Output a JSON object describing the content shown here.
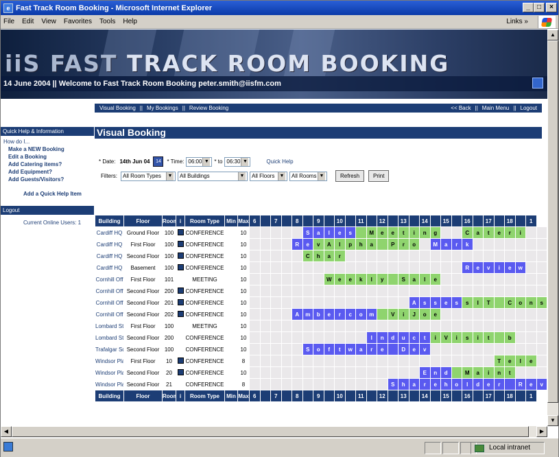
{
  "window": {
    "title": "Fast Track Room Booking - Microsoft Internet Explorer"
  },
  "menu": {
    "items": [
      "File",
      "Edit",
      "View",
      "Favorites",
      "Tools",
      "Help"
    ],
    "links_label": "Links »"
  },
  "banner": {
    "title_a": "iiS FAST",
    "title_b": " TRACK ROOM BOOKING",
    "strip": "14 June 2004   ||   Welcome to Fast Track Room Booking peter.smith@iisfm.com"
  },
  "topnav": {
    "left": [
      "Visual Booking",
      "||",
      "My Bookings",
      "||",
      "Review Booking"
    ],
    "right": [
      "<< Back",
      "||",
      "Main Menu",
      "||",
      "Logout"
    ]
  },
  "sidebar": {
    "quick_help_head": "Quick Help & Information",
    "how_do_i": "How do I...",
    "links": [
      "Make a NEW Booking",
      "Edit a Booking",
      "Add Catering items?",
      "Add Equipment?",
      "Add Guests/Visitors?"
    ],
    "add_quick_help": "Add a Quick Help Item",
    "logout_head": "Logout",
    "online_users": "Current Online Users: 1"
  },
  "main": {
    "title": "Visual Booking",
    "date_label": "* Date:",
    "date_value": "14th Jun 04",
    "time_label": "* Time:",
    "time_from": "06:00",
    "to_label": "* to",
    "time_to": "06:30",
    "quick_help": "Quick Help",
    "filters_label": "Filters:",
    "filter_room_types": "All Room Types",
    "filter_buildings": "All Buildings",
    "filter_floors": "All Floors",
    "filter_rooms": "All Rooms",
    "refresh": "Refresh",
    "print": "Print"
  },
  "grid": {
    "headers": [
      "Building",
      "Floor",
      "Room",
      "i",
      "Room Type",
      "Min",
      "Max",
      "6",
      "",
      "7",
      "",
      "8",
      "",
      "9",
      "",
      "10",
      "",
      "11",
      "",
      "12",
      "",
      "13",
      "",
      "14",
      "",
      "15",
      "",
      "16",
      "",
      "17",
      "",
      "18",
      "",
      "1"
    ],
    "rows": [
      {
        "b": "Cardiff HQ",
        "f": "Ground Floor",
        "r": "100",
        "i": true,
        "t": "CONFERENCE",
        "max": "10",
        "cells": [
          "",
          "",
          "",
          "",
          "",
          [
            "bl",
            "S"
          ],
          [
            "bl",
            "a"
          ],
          [
            "bl",
            "l"
          ],
          [
            "bl",
            "e"
          ],
          [
            "bl",
            "s"
          ],
          [
            "gr",
            ""
          ],
          [
            "gr",
            "M"
          ],
          [
            "gr",
            "e"
          ],
          [
            "gr",
            "e"
          ],
          [
            "gr",
            "t"
          ],
          [
            "gr",
            "i"
          ],
          [
            "gr",
            "n"
          ],
          [
            "gr",
            "g"
          ],
          "",
          "",
          [
            "gr",
            "C"
          ],
          [
            "gr",
            "a"
          ],
          [
            "gr",
            "t"
          ],
          [
            "gr",
            "e"
          ],
          [
            "gr",
            "r"
          ],
          [
            "gr",
            "i"
          ]
        ]
      },
      {
        "b": "Cardiff HQ",
        "f": "First Floor",
        "r": "100",
        "i": true,
        "t": "CONFERENCE",
        "max": "10",
        "cells": [
          "",
          "",
          "",
          "",
          [
            "bl",
            "R"
          ],
          [
            "bl",
            "e"
          ],
          [
            "gr",
            "v"
          ],
          [
            "gr",
            "A"
          ],
          [
            "gr",
            "l"
          ],
          [
            "gr",
            "p"
          ],
          [
            "gr",
            "h"
          ],
          [
            "gr",
            "a"
          ],
          [
            "gr",
            ""
          ],
          [
            "gr",
            "P"
          ],
          [
            "gr",
            "r"
          ],
          [
            "gr",
            "o"
          ],
          "",
          [
            "bl",
            "M"
          ],
          [
            "bl",
            "a"
          ],
          [
            "bl",
            "r"
          ],
          [
            "bl",
            "k"
          ],
          "",
          "",
          "",
          "",
          ""
        ]
      },
      {
        "b": "Cardiff HQ",
        "f": "Second Floor",
        "r": "100",
        "i": true,
        "t": "CONFERENCE",
        "max": "10",
        "cells": [
          "",
          "",
          "",
          "",
          "",
          [
            "gr",
            "C"
          ],
          [
            "gr",
            "h"
          ],
          [
            "gr",
            "a"
          ],
          [
            "gr",
            "r"
          ],
          "",
          "",
          "",
          "",
          "",
          "",
          "",
          "",
          "",
          "",
          "",
          "",
          "",
          "",
          "",
          "",
          ""
        ]
      },
      {
        "b": "Cardiff HQ",
        "f": "Basement",
        "r": "100",
        "i": true,
        "t": "CONFERENCE",
        "max": "10",
        "cells": [
          "",
          "",
          "",
          "",
          "",
          "",
          "",
          "",
          "",
          "",
          "",
          "",
          "",
          "",
          "",
          "",
          "",
          "",
          "",
          "",
          [
            "bl",
            "R"
          ],
          [
            "bl",
            "e"
          ],
          [
            "bl",
            "v"
          ],
          [
            "bl",
            "i"
          ],
          [
            "bl",
            "e"
          ],
          [
            "bl",
            "w"
          ]
        ]
      },
      {
        "b": "Cornhill Off",
        "f": "First Floor",
        "r": "101",
        "i": false,
        "t": "MEETING",
        "max": "10",
        "cells": [
          "",
          "",
          "",
          "",
          "",
          "",
          "",
          [
            "gr",
            "W"
          ],
          [
            "gr",
            "e"
          ],
          [
            "gr",
            "e"
          ],
          [
            "gr",
            "k"
          ],
          [
            "gr",
            "l"
          ],
          [
            "gr",
            "y"
          ],
          [
            "gr",
            ""
          ],
          [
            "gr",
            "S"
          ],
          [
            "gr",
            "a"
          ],
          [
            "gr",
            "l"
          ],
          [
            "gr",
            "e"
          ],
          "",
          "",
          "",
          "",
          "",
          "",
          "",
          ""
        ]
      },
      {
        "b": "Cornhill Off",
        "f": "Second Floor",
        "r": "200",
        "i": true,
        "t": "CONFERENCE",
        "max": "10",
        "cells": [
          "",
          "",
          "",
          "",
          "",
          "",
          "",
          "",
          "",
          "",
          "",
          "",
          "",
          "",
          "",
          "",
          "",
          "",
          "",
          "",
          "",
          "",
          "",
          "",
          "",
          ""
        ]
      },
      {
        "b": "Cornhill Off",
        "f": "Second Floor",
        "r": "201",
        "i": true,
        "t": "CONFERENCE",
        "max": "10",
        "cells": [
          "",
          "",
          "",
          "",
          "",
          "",
          "",
          "",
          "",
          "",
          "",
          "",
          "",
          "",
          "",
          [
            "bl",
            "A"
          ],
          [
            "bl",
            "s"
          ],
          [
            "bl",
            "s"
          ],
          [
            "bl",
            "e"
          ],
          [
            "bl",
            "s"
          ],
          [
            "gr",
            "s"
          ],
          [
            "gr",
            "I"
          ],
          [
            "gr",
            "T"
          ],
          [
            "gr",
            ""
          ],
          [
            "gr",
            "C"
          ],
          [
            "gr",
            "o"
          ],
          [
            "gr",
            "n"
          ],
          [
            "gr",
            "s"
          ]
        ]
      },
      {
        "b": "Cornhill Off",
        "f": "Second Floor",
        "r": "202",
        "i": true,
        "t": "CONFERENCE",
        "max": "10",
        "cells": [
          "",
          "",
          "",
          "",
          [
            "bl",
            "A"
          ],
          [
            "bl",
            "m"
          ],
          [
            "bl",
            "b"
          ],
          [
            "bl",
            "e"
          ],
          [
            "bl",
            "r"
          ],
          [
            "bl",
            "c"
          ],
          [
            "bl",
            "o"
          ],
          [
            "bl",
            "m"
          ],
          [
            "gr",
            ""
          ],
          [
            "gr",
            "V"
          ],
          [
            "gr",
            "i"
          ],
          [
            "gr",
            "J"
          ],
          [
            "gr",
            "o"
          ],
          [
            "gr",
            "e"
          ],
          "",
          "",
          "",
          "",
          "",
          "",
          "",
          ""
        ]
      },
      {
        "b": "Lombard St.",
        "f": "First Floor",
        "r": "100",
        "i": false,
        "t": "MEETING",
        "max": "10",
        "cells": [
          "",
          "",
          "",
          "",
          "",
          "",
          "",
          "",
          "",
          "",
          "",
          "",
          "",
          "",
          "",
          "",
          "",
          "",
          "",
          "",
          "",
          "",
          "",
          "",
          "",
          ""
        ]
      },
      {
        "b": "Lombard St.",
        "f": "Second Floor",
        "r": "200",
        "i": false,
        "t": "CONFERENCE",
        "max": "10",
        "cells": [
          "",
          "",
          "",
          "",
          "",
          "",
          "",
          "",
          "",
          "",
          "",
          [
            "bl",
            "I"
          ],
          [
            "bl",
            "n"
          ],
          [
            "bl",
            "d"
          ],
          [
            "bl",
            "u"
          ],
          [
            "bl",
            "c"
          ],
          [
            "bl",
            "t"
          ],
          [
            "gr",
            "i"
          ],
          [
            "gr",
            "V"
          ],
          [
            "gr",
            "i"
          ],
          [
            "gr",
            "s"
          ],
          [
            "gr",
            "i"
          ],
          [
            "gr",
            "t"
          ],
          [
            "gr",
            ""
          ],
          [
            "gr",
            "b"
          ],
          ""
        ]
      },
      {
        "b": "Trafalgar Sq",
        "f": "Second Floor",
        "r": "100",
        "i": false,
        "t": "CONFERENCE",
        "max": "10",
        "cells": [
          "",
          "",
          "",
          "",
          "",
          [
            "bl",
            "S"
          ],
          [
            "bl",
            "o"
          ],
          [
            "bl",
            "f"
          ],
          [
            "bl",
            "t"
          ],
          [
            "bl",
            "w"
          ],
          [
            "bl",
            "a"
          ],
          [
            "bl",
            "r"
          ],
          [
            "bl",
            "e"
          ],
          [
            "bl",
            ""
          ],
          [
            "bl",
            "D"
          ],
          [
            "bl",
            "e"
          ],
          [
            "bl",
            "v"
          ],
          "",
          "",
          "",
          "",
          "",
          "",
          "",
          "",
          ""
        ]
      },
      {
        "b": "Windsor Plac",
        "f": "First Floor",
        "r": "10",
        "i": true,
        "t": "CONFERENCE",
        "max": "8",
        "cells": [
          "",
          "",
          "",
          "",
          "",
          "",
          "",
          "",
          "",
          "",
          "",
          "",
          "",
          "",
          "",
          "",
          "",
          "",
          "",
          "",
          "",
          "",
          "",
          [
            "gr",
            "T"
          ],
          [
            "gr",
            "e"
          ],
          [
            "gr",
            "l"
          ],
          [
            "gr",
            "e"
          ]
        ]
      },
      {
        "b": "Windsor Plac",
        "f": "Second Floor",
        "r": "20",
        "i": true,
        "t": "CONFERENCE",
        "max": "10",
        "cells": [
          "",
          "",
          "",
          "",
          "",
          "",
          "",
          "",
          "",
          "",
          "",
          "",
          "",
          "",
          "",
          "",
          [
            "bl",
            "E"
          ],
          [
            "bl",
            "n"
          ],
          [
            "bl",
            "d"
          ],
          [
            "gr",
            ""
          ],
          [
            "gr",
            "M"
          ],
          [
            "gr",
            "a"
          ],
          [
            "gr",
            "i"
          ],
          [
            "gr",
            "n"
          ],
          [
            "gr",
            "t"
          ],
          ""
        ]
      },
      {
        "b": "Windsor Plac",
        "f": "Second Floor",
        "r": "21",
        "i": false,
        "t": "CONFERENCE",
        "max": "8",
        "cells": [
          "",
          "",
          "",
          "",
          "",
          "",
          "",
          "",
          "",
          "",
          "",
          "",
          "",
          [
            "bl",
            "S"
          ],
          [
            "bl",
            "h"
          ],
          [
            "bl",
            "a"
          ],
          [
            "bl",
            "r"
          ],
          [
            "bl",
            "e"
          ],
          [
            "bl",
            "h"
          ],
          [
            "bl",
            "o"
          ],
          [
            "bl",
            "l"
          ],
          [
            "bl",
            "d"
          ],
          [
            "bl",
            "e"
          ],
          [
            "bl",
            "r"
          ],
          [
            "bl",
            ""
          ],
          [
            "bl",
            "R"
          ],
          [
            "bl",
            "e"
          ],
          [
            "bl",
            "v"
          ],
          [
            "bl",
            "i"
          ]
        ]
      }
    ]
  },
  "status": {
    "zone": "Local intranet"
  },
  "colors": {
    "navy": "#1c3d75",
    "booked_blue": "#5a5af0",
    "booked_green": "#8fd46e"
  }
}
